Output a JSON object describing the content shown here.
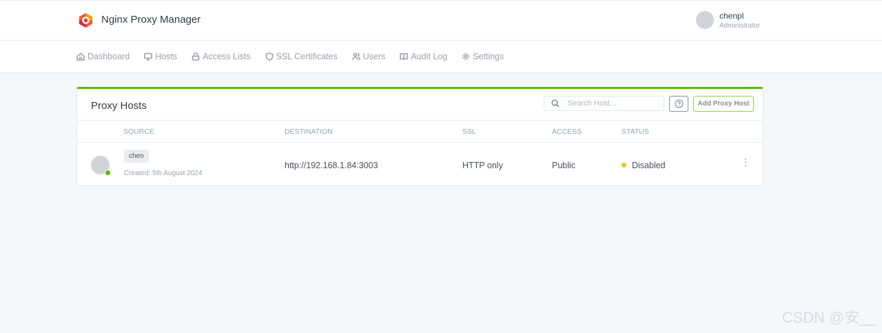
{
  "header": {
    "title": "Nginx Proxy Manager",
    "user": {
      "name": "chenpl",
      "role": "Administrator"
    }
  },
  "nav": [
    {
      "label": "Dashboard",
      "icon": "home-icon"
    },
    {
      "label": "Hosts",
      "icon": "monitor-icon"
    },
    {
      "label": "Access Lists",
      "icon": "lock-icon"
    },
    {
      "label": "SSL Certificates",
      "icon": "shield-icon"
    },
    {
      "label": "Users",
      "icon": "users-icon"
    },
    {
      "label": "Audit Log",
      "icon": "book-icon"
    },
    {
      "label": "Settings",
      "icon": "gear-icon"
    }
  ],
  "card": {
    "title": "Proxy Hosts",
    "search_placeholder": "Search Host…",
    "add_label": "Add Proxy Host",
    "columns": [
      "SOURCE",
      "DESTINATION",
      "SSL",
      "ACCESS",
      "STATUS"
    ],
    "rows": [
      {
        "source": "chen",
        "created": "Created: 5th August 2024",
        "destination": "http://192.168.1.84:3003",
        "ssl": "HTTP only",
        "access": "Public",
        "status": "Disabled"
      }
    ]
  },
  "colors": {
    "accent": "#5eba00",
    "status_disabled": "#f1c40f"
  },
  "watermark": "CSDN @安__"
}
